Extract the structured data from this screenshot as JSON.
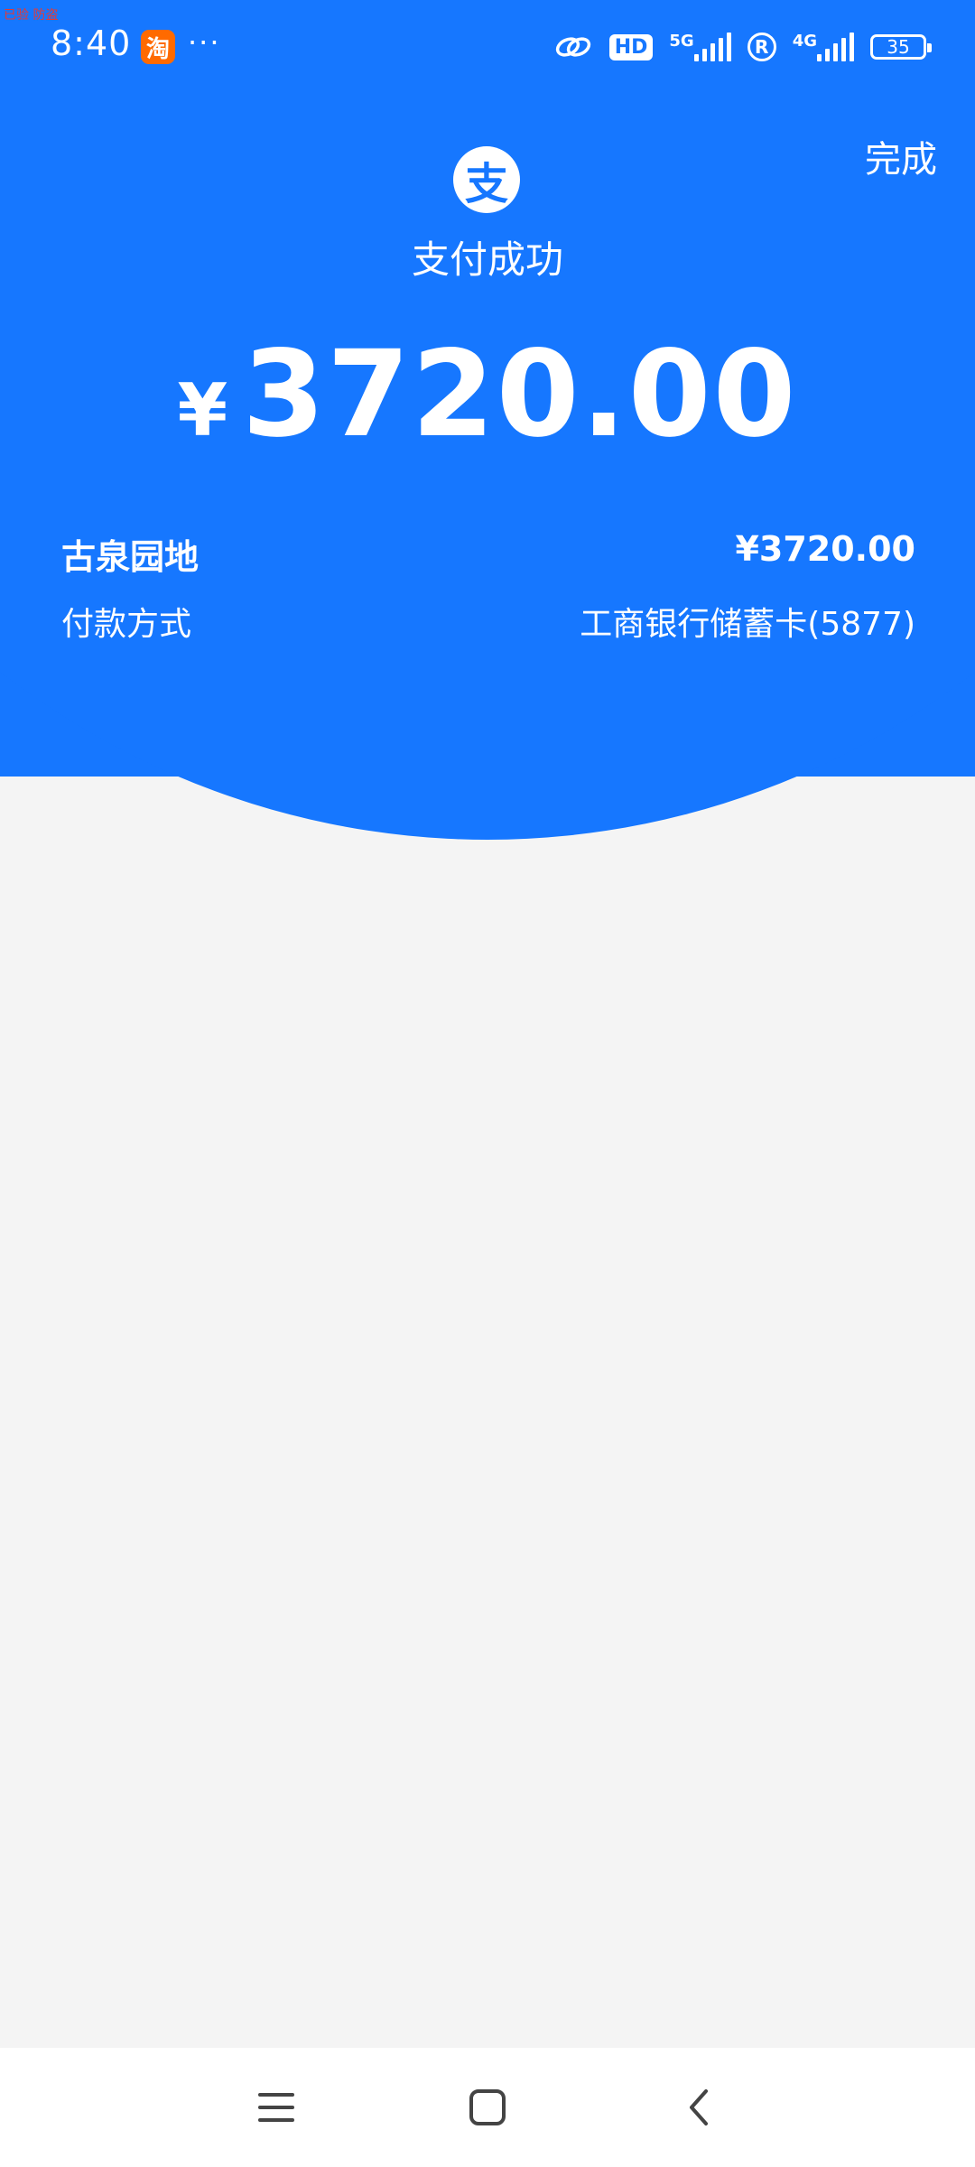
{
  "status_bar": {
    "time": "8:40",
    "taobao_glyph": "淘",
    "more": "···",
    "hd_label": "HD",
    "net_5g": "5G",
    "net_4g": "4G",
    "reg_mark": "R",
    "battery": "35",
    "tiny_badge": "已验 防盗"
  },
  "header": {
    "done_label": "完成",
    "logo_glyph": "支",
    "title": "支付成功"
  },
  "amount": {
    "currency": "¥",
    "value": "3720.00"
  },
  "details": {
    "merchant_label": "古泉园地",
    "merchant_amount": "¥3720.00",
    "method_label": "付款方式",
    "method_value": "工商银行储蓄卡(5877)"
  },
  "nav": {
    "menu_icon": "menu-icon",
    "home_icon": "home-icon",
    "back_icon": "back-icon"
  },
  "colors": {
    "brand_blue": "#1677ff",
    "page_bg": "#f4f4f4"
  }
}
